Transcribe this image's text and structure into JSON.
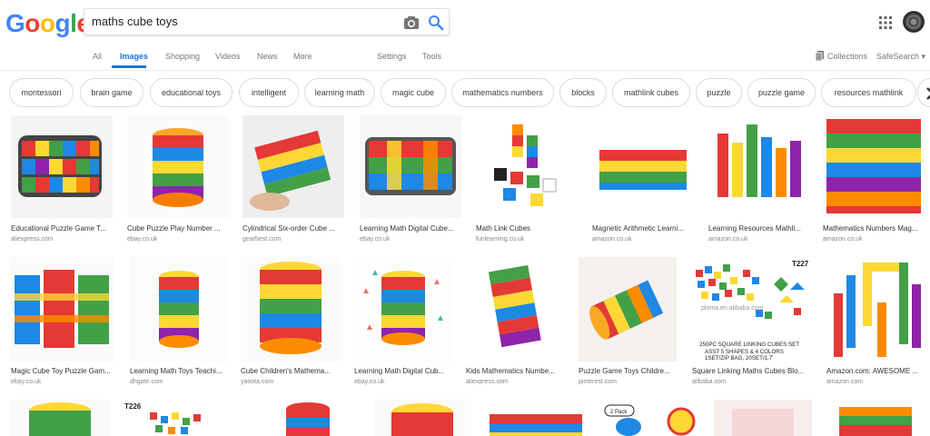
{
  "logo": [
    "G",
    "o",
    "o",
    "g",
    "l",
    "e"
  ],
  "search": {
    "value": "maths cube toys",
    "placeholder": ""
  },
  "tabs": [
    "All",
    "Images",
    "Shopping",
    "Videos",
    "News",
    "More",
    "Settings",
    "Tools"
  ],
  "right_tools": {
    "collections": "Collections",
    "safesearch": "SafeSearch ▾"
  },
  "chips": [
    "montessori",
    "brain game",
    "educational toys",
    "intelligent",
    "learning math",
    "magic cube",
    "mathematics numbers",
    "blocks",
    "mathlink cubes",
    "puzzle",
    "puzzle game",
    "resources mathlink"
  ],
  "results": [
    {
      "caption": "Educational Puzzle Game T...",
      "source": "aliexpress.com"
    },
    {
      "caption": "Cube Puzzle Play Number ...",
      "source": "ebay.co.uk"
    },
    {
      "caption": "Cylindrical Six-order Cube ...",
      "source": "gearbest.com"
    },
    {
      "caption": "Learning Math Digital Cube...",
      "source": "ebay.co.uk"
    },
    {
      "caption": "Math Link Cubes",
      "source": "funlearning.co.uk"
    },
    {
      "caption": "Magnetic Arithmetic Learni...",
      "source": "amazon.co.uk"
    },
    {
      "caption": "Learning Resources Mathli...",
      "source": "amazon.co.uk"
    },
    {
      "caption": "Mathematics Numbers Mag...",
      "source": "amazon.co.uk"
    },
    {
      "caption": "Magic Cube Toy Puzzle Gam...",
      "source": "ebay.co.uk"
    },
    {
      "caption": "Learning Math Toys Teachi...",
      "source": "dhgate.com"
    },
    {
      "caption": "Cube Children's Mathema...",
      "source": "yaoota.com"
    },
    {
      "caption": "Learning Math Digital Cub...",
      "source": "ebay.co.uk"
    },
    {
      "caption": "Kids Mathematics Numbe...",
      "source": "aliexpress.com"
    },
    {
      "caption": "Puzzle Game Toys Childre...",
      "source": "pinterest.com"
    },
    {
      "caption": "Square Linking Maths Cubes Blo...",
      "source": "alibaba.com"
    },
    {
      "caption": "Amazon.com: AWESOME ...",
      "source": "amazon.com"
    }
  ],
  "image_text": {
    "t227": "T227",
    "t226": "T226",
    "ploma": "ploma.en.alibaba.com",
    "cube_desc_1": "250PC SQUARE LINKING CUBES SET",
    "cube_desc_2": "ASST 5 SHAPES & 4 COLORS",
    "cube_desc_3": "1SET/ZIP BAG, 20SET/1.7'",
    "pack": "2 Pack"
  },
  "colors": {
    "accent": "#1a73e8",
    "chip_border": "#dadce0"
  }
}
